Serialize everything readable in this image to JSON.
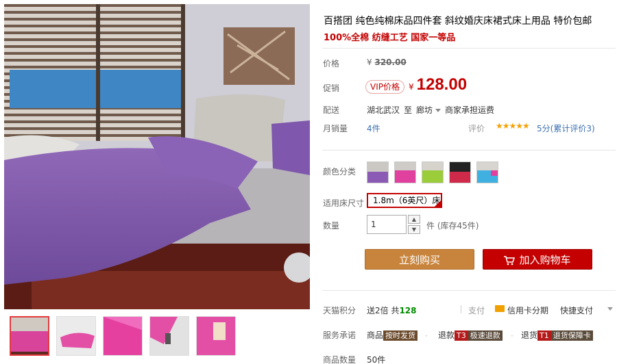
{
  "product": {
    "title": "百搭团 纯色纯棉床品四件套 斜纹婚庆床裙式床上用品 特价包邮",
    "subtitle": "100%全棉 纺缝工艺 国家一等品"
  },
  "price": {
    "label": "价格",
    "currency": "¥",
    "original": "320.00"
  },
  "promo": {
    "label": "促销",
    "badge": "VIP价格",
    "currency": "¥",
    "price": "128.00"
  },
  "shipping": {
    "label": "配送",
    "from": "湖北武汉",
    "to_word": "至",
    "to": "廊坊",
    "fee": "商家承担运费"
  },
  "sales": {
    "label": "月销量",
    "value": "4件",
    "rating_label": "评价",
    "stars": "★★★★★",
    "rating_text": "5分(累计评价3)"
  },
  "options": {
    "color_label": "颜色分类",
    "size_label": "适用床尺寸",
    "size_value": "1.8m（6英尺）床",
    "quantity_label": "数量",
    "quantity_value": "1",
    "stock_text": "件 (库存45件)"
  },
  "actions": {
    "buy_now": "立刻购买",
    "add_to_cart": "加入购物车"
  },
  "points": {
    "label": "天猫积分",
    "text_prefix": "送2倍 共",
    "value": "128",
    "pay_label": "支付",
    "credit": "信用卡分期",
    "quick_pay": "快捷支付"
  },
  "service": {
    "label": "服务承诺",
    "item1_prefix": "商品",
    "item1_tag": "按时发货",
    "item2_prefix": "退款",
    "item2_code": "T3",
    "item2_tag": "极速退款",
    "item3_prefix": "退货",
    "item3_code": "T1",
    "item3_tag": "退货保障卡"
  },
  "stock": {
    "label": "商品数量",
    "value": "50件"
  },
  "colors": {
    "accent_red": "#c40000",
    "buy_orange": "#c8843c",
    "star_gold": "#f5a000"
  }
}
